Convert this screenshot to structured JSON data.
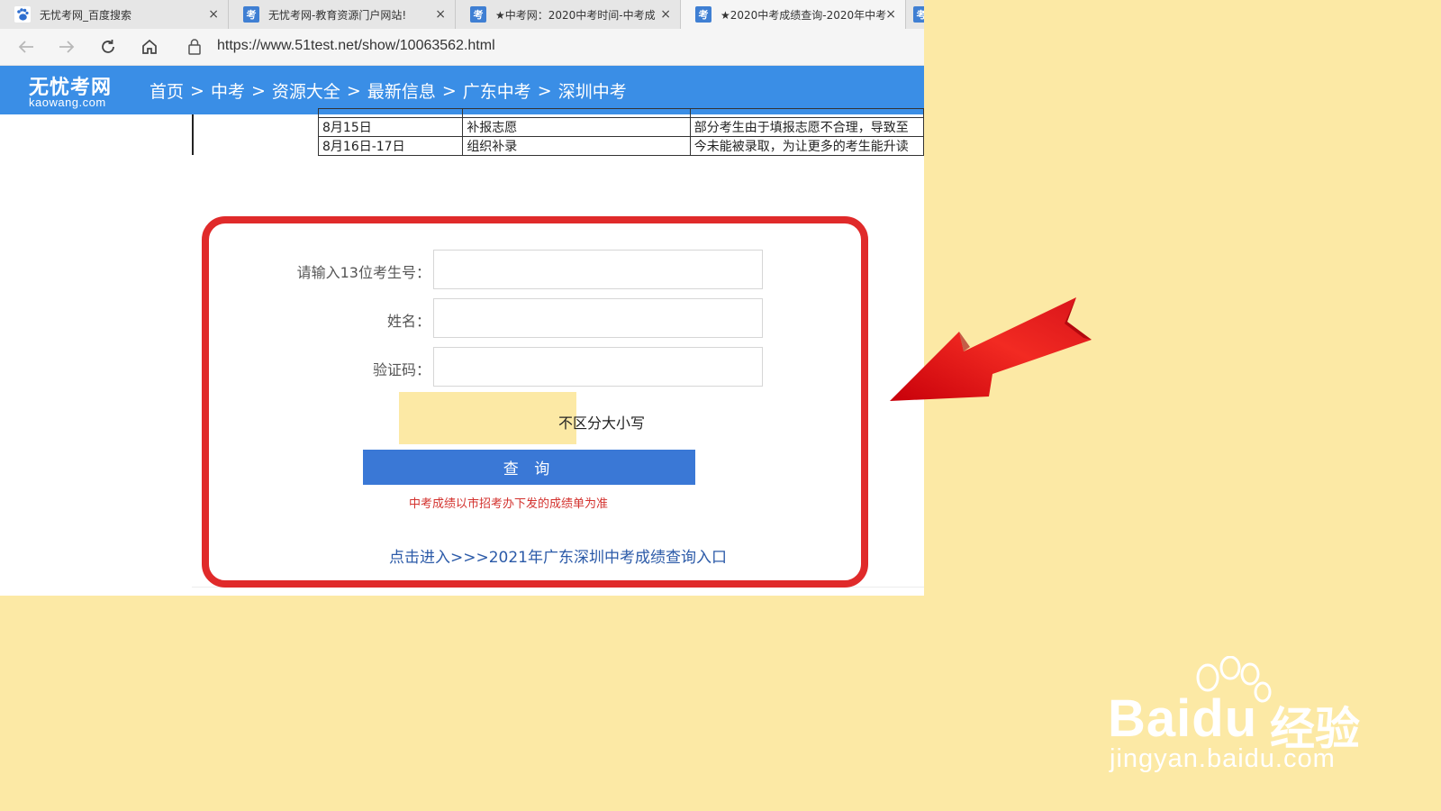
{
  "browser": {
    "tabs": [
      {
        "title": "无忧考网_百度搜索",
        "icon": "baidu-paw-icon"
      },
      {
        "title": "无忧考网-教育资源门户网站!",
        "icon": "kaowang-icon"
      },
      {
        "title": "★中考网：2020中考时间-中考成",
        "icon": "kaowang-icon"
      },
      {
        "title": "★2020中考成绩查询-2020年中考",
        "icon": "kaowang-icon"
      },
      {
        "title": "",
        "icon": "kaowang-icon"
      }
    ],
    "close_glyph": "×",
    "url": "https://www.51test.net/show/10063562.html"
  },
  "site": {
    "logo_main": "无忧考网",
    "logo_sub": "kaowang.com",
    "breadcrumb": [
      "首页",
      "中考",
      "资源大全",
      "最新信息",
      "广东中考",
      "深圳中考"
    ],
    "breadcrumb_sep": ">"
  },
  "schedule_table": {
    "rows": [
      {
        "date": "8月15日",
        "item": "补报志愿",
        "desc": "部分考生由于填报志愿不合理，导致至"
      },
      {
        "date": "8月16日-17日",
        "item": "组织补录",
        "desc": "今未能被录取，为让更多的考生能升读"
      }
    ]
  },
  "form": {
    "exam_number_label": "请输入13位考生号：",
    "name_label": "姓名：",
    "captcha_label": "验证码：",
    "case_note": "不区分大小写",
    "query_button": "查 询",
    "notice": "中考成绩以市招考办下发的成绩单为准",
    "entry_link": "点击进入>>>2021年广东深圳中考成绩查询入口"
  },
  "watermark": {
    "brand": "Bai",
    "brand_du": "du",
    "brand_cn": "经验",
    "url": "jingyan.baidu.com"
  },
  "colors": {
    "page_bg": "#fce9a5",
    "header_blue": "#3a8ee6",
    "highlight_red": "#e02a2a",
    "button_blue": "#3a78d6",
    "notice_red": "#d3322e",
    "link_blue": "#2b5aa8"
  }
}
